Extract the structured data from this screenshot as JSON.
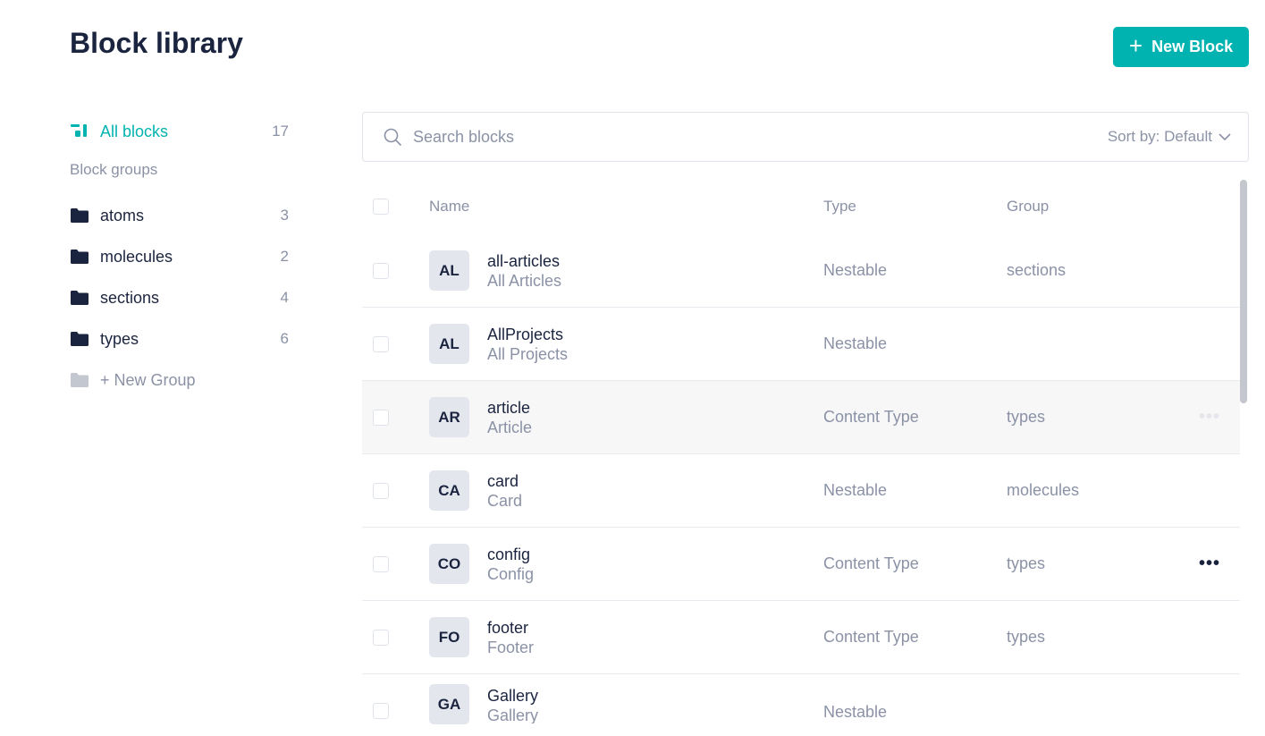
{
  "page": {
    "title": "Block library"
  },
  "new_block_button": {
    "label": "New Block"
  },
  "sidebar": {
    "all_blocks": {
      "label": "All blocks",
      "count": "17"
    },
    "groups_heading": "Block groups",
    "groups": [
      {
        "label": "atoms",
        "count": "3"
      },
      {
        "label": "molecules",
        "count": "2"
      },
      {
        "label": "sections",
        "count": "4"
      },
      {
        "label": "types",
        "count": "6"
      }
    ],
    "new_group": {
      "label": "+ New Group"
    }
  },
  "search": {
    "placeholder": "Search blocks",
    "sort_label": "Sort by: Default"
  },
  "table": {
    "columns": {
      "name": "Name",
      "type": "Type",
      "group": "Group"
    },
    "rows": [
      {
        "badge": "AL",
        "name": "all-articles",
        "display": "All Articles",
        "type": "Nestable",
        "group": "sections"
      },
      {
        "badge": "AL",
        "name": "AllProjects",
        "display": "All Projects",
        "type": "Nestable",
        "group": ""
      },
      {
        "badge": "AR",
        "name": "article",
        "display": "Article",
        "type": "Content Type",
        "group": "types"
      },
      {
        "badge": "CA",
        "name": "card",
        "display": "Card",
        "type": "Nestable",
        "group": "molecules"
      },
      {
        "badge": "CO",
        "name": "config",
        "display": "Config",
        "type": "Content Type",
        "group": "types"
      },
      {
        "badge": "FO",
        "name": "footer",
        "display": "Footer",
        "type": "Content Type",
        "group": "types"
      },
      {
        "badge": "GA",
        "name": "Gallery",
        "display": "Gallery",
        "type": "Nestable",
        "group": ""
      }
    ]
  },
  "colors": {
    "accent": "#00b3b0",
    "text": "#1b243f",
    "muted": "#8b92a6"
  },
  "icons": {
    "all_blocks": "blocks-icon",
    "group": "folder-icon",
    "search": "search-icon",
    "sort": "chevron-down-icon",
    "row_menu": "more-horizontal-icon"
  }
}
